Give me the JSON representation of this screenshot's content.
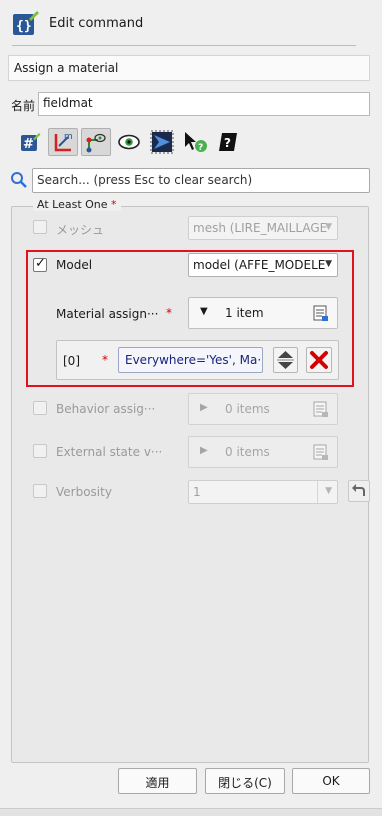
{
  "header": {
    "title": "Edit command"
  },
  "description": "Assign a material",
  "name_field": {
    "label": "名前",
    "value": "fieldmat"
  },
  "toolbar": {
    "items": [
      {
        "name": "hash-icon"
      },
      {
        "name": "axes-icon"
      },
      {
        "name": "graph-icon"
      },
      {
        "name": "eye-icon"
      },
      {
        "name": "view-icon"
      },
      {
        "name": "whats-this-icon"
      },
      {
        "name": "book-icon"
      }
    ]
  },
  "search": {
    "placeholder": "Search... (press Esc to clear search)"
  },
  "group": {
    "title": "At Least One",
    "required_mark": "*",
    "rows": {
      "mesh": {
        "label": "メッシュ",
        "value": "mesh (LIRE_MAILLAGE"
      },
      "model": {
        "label": "Model",
        "value": "model (AFFE_MODELE"
      },
      "material_assign": {
        "label": "Material assign···",
        "required_mark": "*",
        "count": "1 item"
      },
      "material_item": {
        "index": "[0]",
        "required_mark": "*",
        "value": "Everywhere='Yes', Ma···"
      },
      "behavior": {
        "label": "Behavior assig···",
        "count": "0 items"
      },
      "external_state": {
        "label": "External state v···",
        "count": "0 items"
      },
      "verbosity": {
        "label": "Verbosity",
        "value": "1"
      }
    }
  },
  "footer": {
    "apply": "適用",
    "close": "閉じる(C)",
    "ok": "OK"
  },
  "colors": {
    "highlight": "#e0121b",
    "required": "#d40000",
    "value_text": "#1a237e"
  }
}
